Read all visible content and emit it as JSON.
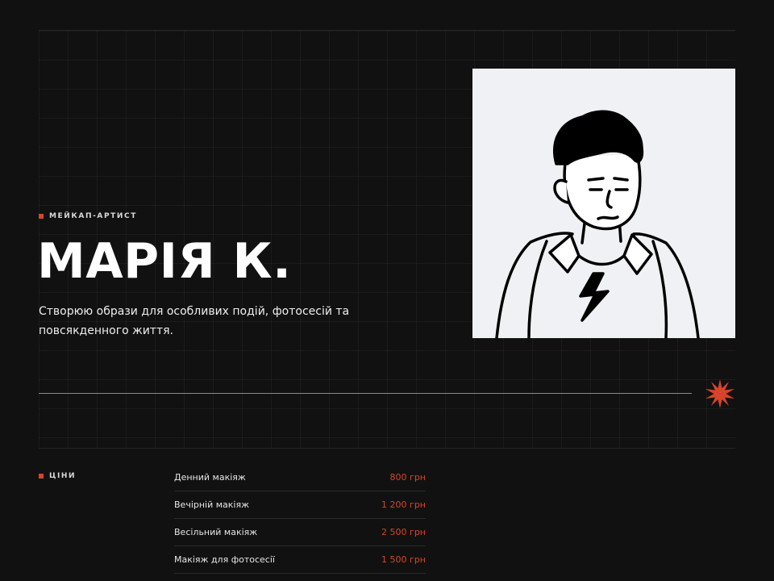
{
  "hero": {
    "eyebrow": "МЕЙКАП-АРТИСТ",
    "title": "МАРІЯ К.",
    "subtitle": "Створюю образи для особливих подій, фотосесій та повсякденного життя."
  },
  "prices": {
    "label": "ЦІНИ",
    "items": [
      {
        "name": "Денний макіяж",
        "price": "800 грн"
      },
      {
        "name": "Вечірній макіяж",
        "price": "1 200 грн"
      },
      {
        "name": "Весільний макіяж",
        "price": "2 500 грн"
      },
      {
        "name": "Макіяж для фотосесії",
        "price": "1 500 грн"
      }
    ]
  },
  "icons": {
    "accent_square": "square-bullet-icon",
    "star": "starburst-icon"
  },
  "colors": {
    "background": "#111111",
    "accent": "#d8442a",
    "text": "#ffffff",
    "portrait_bg": "#f0f1f4"
  }
}
